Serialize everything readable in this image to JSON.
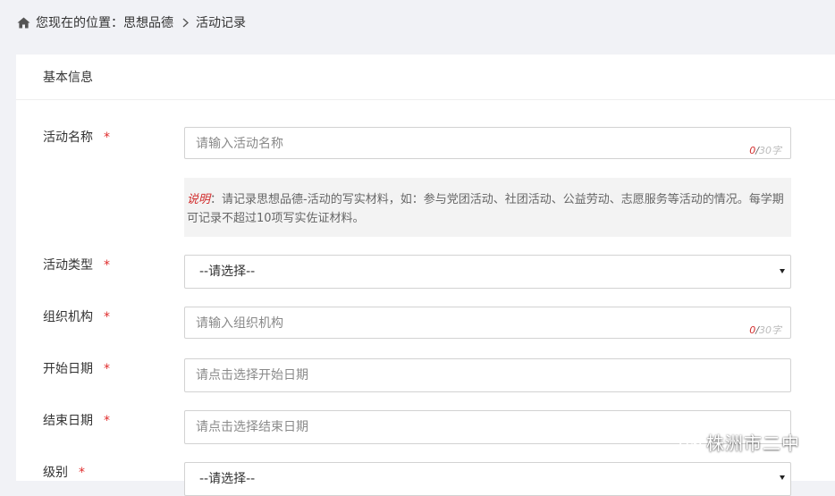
{
  "breadcrumb": {
    "prefix": "您现在的位置：",
    "section": "思想品德",
    "current": "活动记录"
  },
  "card": {
    "header": "基本信息"
  },
  "form": {
    "activity_name": {
      "label": "活动名称",
      "required": "*",
      "placeholder": "请输入活动名称",
      "count_current": "0",
      "count_sep": "/",
      "count_max": "30字"
    },
    "note": {
      "tag": "说明",
      "text": "：请记录思想品德-活动的写实材料，如：参与党团活动、社团活动、公益劳动、志愿服务等活动的情况。每学期可记录不超过10项写实佐证材料。"
    },
    "activity_type": {
      "label": "活动类型",
      "required": "*",
      "selected": "--请选择--"
    },
    "organization": {
      "label": "组织机构",
      "required": "*",
      "placeholder": "请输入组织机构",
      "count_current": "0",
      "count_sep": "/",
      "count_max": "30字"
    },
    "start_date": {
      "label": "开始日期",
      "required": "*",
      "placeholder": "请点击选择开始日期"
    },
    "end_date": {
      "label": "结束日期",
      "required": "*",
      "placeholder": "请点击选择结束日期"
    },
    "level": {
      "label": "级别",
      "required": "*",
      "selected": "--请选择--"
    }
  },
  "watermark": {
    "text": "株洲市二中"
  },
  "colors": {
    "page_bg": "#f1f2f6",
    "required": "#e02c2c",
    "note_bg": "#f3f3f3",
    "border": "#d2d2d2"
  }
}
